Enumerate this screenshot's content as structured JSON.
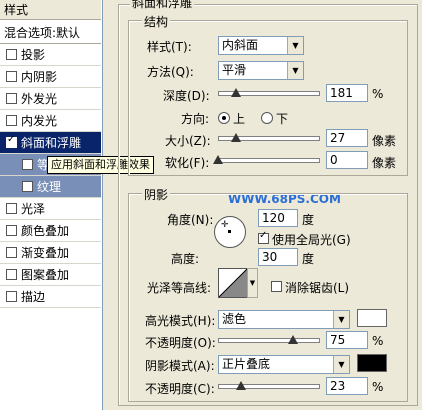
{
  "left_panel": {
    "header": "样式",
    "blend": "混合选项:默认",
    "items": [
      {
        "label": "投影",
        "checked": false,
        "state": "normal"
      },
      {
        "label": "内阴影",
        "checked": false,
        "state": "normal"
      },
      {
        "label": "外发光",
        "checked": false,
        "state": "normal"
      },
      {
        "label": "内发光",
        "checked": false,
        "state": "normal"
      },
      {
        "label": "斜面和浮雕",
        "checked": true,
        "state": "selected"
      },
      {
        "label": "等",
        "checked": false,
        "state": "sub"
      },
      {
        "label": "纹理",
        "checked": false,
        "state": "sub"
      },
      {
        "label": "光泽",
        "checked": false,
        "state": "normal"
      },
      {
        "label": "颜色叠加",
        "checked": false,
        "state": "normal"
      },
      {
        "label": "渐变叠加",
        "checked": false,
        "state": "normal"
      },
      {
        "label": "图案叠加",
        "checked": false,
        "state": "normal"
      },
      {
        "label": "描边",
        "checked": false,
        "state": "normal"
      }
    ]
  },
  "tooltip": "应用斜面和浮雕效果",
  "watermark": "WWW.68PS.COM",
  "bevel": {
    "title": "斜面和浮雕",
    "structure": {
      "title": "结构",
      "style_label": "样式(T):",
      "style_value": "内斜面",
      "technique_label": "方法(Q):",
      "technique_value": "平滑",
      "depth_label": "深度(D):",
      "depth_value": "181",
      "depth_level": 0.18,
      "percent": "%",
      "direction_label": "方向:",
      "direction_up": "上",
      "direction_down": "下",
      "direction_selected": "up",
      "size_label": "大小(Z):",
      "size_value": "27",
      "size_level": 0.18,
      "soften_label": "软化(F):",
      "soften_value": "0",
      "soften_level": 0.0,
      "px": "像素"
    },
    "shading": {
      "title": "阴影",
      "angle_label": "角度(N):",
      "angle_value": "120",
      "degree": "度",
      "global_light_label": "使用全局光(G)",
      "global_light_checked": true,
      "altitude_label": "高度:",
      "altitude_value": "30",
      "gloss_label": "光泽等高线:",
      "antialias_label": "消除锯齿(L)",
      "antialias_checked": false,
      "highlight_mode_label": "高光模式(H):",
      "highlight_mode_value": "滤色",
      "highlight_color": "#ffffff",
      "highlight_opacity_label": "不透明度(O):",
      "highlight_opacity_value": "75",
      "highlight_opacity_level": 0.75,
      "shadow_mode_label": "阴影模式(A):",
      "shadow_mode_value": "正片叠底",
      "shadow_color": "#000000",
      "shadow_opacity_label": "不透明度(C):",
      "shadow_opacity_value": "23",
      "shadow_opacity_level": 0.23
    }
  }
}
